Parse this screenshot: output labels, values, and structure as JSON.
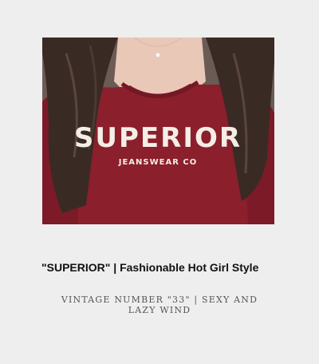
{
  "product": {
    "image_alt": "Model wearing burgundy long-sleeve top",
    "shirt_print_line1": "SUPERIOR",
    "shirt_print_line2": "JEANSWEAR CO",
    "title": "\"SUPERIOR\" | Fashionable Hot Girl Style",
    "subtitle": "VINTAGE NUMBER \"33\" | SEXY AND LAZY WIND"
  },
  "colors": {
    "background": "#efeeee",
    "shirt": "#8b1f2c",
    "hair": "#3a2a24",
    "skin": "#e9c8b8",
    "print": "#f3eee6"
  }
}
